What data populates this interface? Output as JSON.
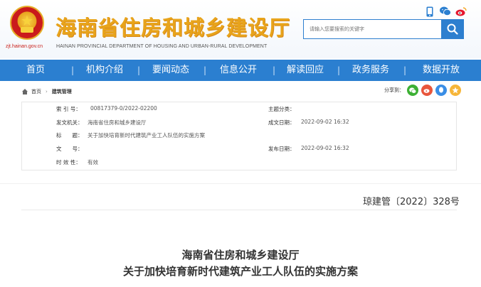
{
  "header": {
    "site_title": "海南省住房和城乡建设厅",
    "site_subtitle": "HAINAN PROVINCIAL DEPARTMENT OF HOUSING AND URBAN-RURAL DEVELOPMENT",
    "site_url": "zjt.hainan.gov.cn",
    "search_placeholder": "请输入您要搜索的关键字",
    "icons": [
      "mobile-icon",
      "wechat-icon",
      "weibo-icon"
    ]
  },
  "nav": {
    "items": [
      "首页",
      "机构介绍",
      "要闻动态",
      "信息公开",
      "解读回应",
      "政务服务",
      "数据开放"
    ]
  },
  "breadcrumb": {
    "home": "首页",
    "current": "建筑管理"
  },
  "share": {
    "label": "分享到："
  },
  "info": {
    "index_label": "索 引 号：",
    "index_value": "00817379-0/2022-02200",
    "subject_label": "主题分类：",
    "subject_value": "",
    "issuer_label": "发文机关：",
    "issuer_value": "海南省住房和城乡建设厅",
    "date_label": "成文日期：",
    "date_value": "2022-09-02 16:32",
    "title_label": "标　　题：",
    "title_value": "关于加快培育新时代建筑产业工人队伍的实施方案",
    "docnum_label": "文　　号：",
    "docnum_value": "",
    "pub_label": "发布日期：",
    "pub_value": "2022-09-02 16:32",
    "validity_label": "时 效 性：",
    "validity_value": "有效"
  },
  "document": {
    "number": "琼建管〔2022〕328号",
    "title_line1": "海南省住房和城乡建设厅",
    "title_line2": "关于加快培育新时代建筑产业工人队伍的实施方案"
  },
  "colors": {
    "nav_blue": "#2b7fd0",
    "title_gold": "#e8a41b",
    "emblem_red": "#c8191a"
  }
}
